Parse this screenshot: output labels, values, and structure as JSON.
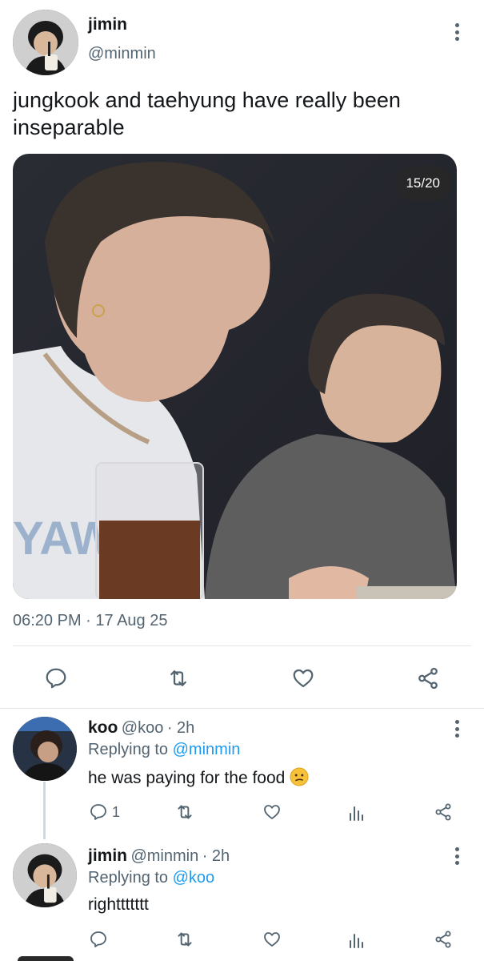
{
  "main_tweet": {
    "author_name": "jimin",
    "author_handle": "@minmin",
    "text": "jungkook and taehyung have really been inseparable",
    "media_counter": "15/20",
    "media_overlay_text": "YAW",
    "timestamp": "06:20 PM · 17 Aug 25",
    "actions": [
      "reply-icon",
      "retweet-icon",
      "like-icon",
      "share-icon"
    ]
  },
  "replies": [
    {
      "author_name": "koo",
      "author_handle": "@koo",
      "time": "· 2h",
      "replying_label": "Replying to",
      "replying_to": "@minmin",
      "text": "he was paying for the food",
      "emoji": "😕",
      "reply_count": "1"
    },
    {
      "author_name": "jimin",
      "author_handle": "@minmin",
      "time": "· 2h",
      "replying_label": "Replying to",
      "replying_to": "@koo",
      "text": "righttttttt"
    }
  ],
  "colors": {
    "link": "#1d9bf0",
    "muted": "#536471",
    "text": "#14171a",
    "divider": "#e6e6e6"
  }
}
